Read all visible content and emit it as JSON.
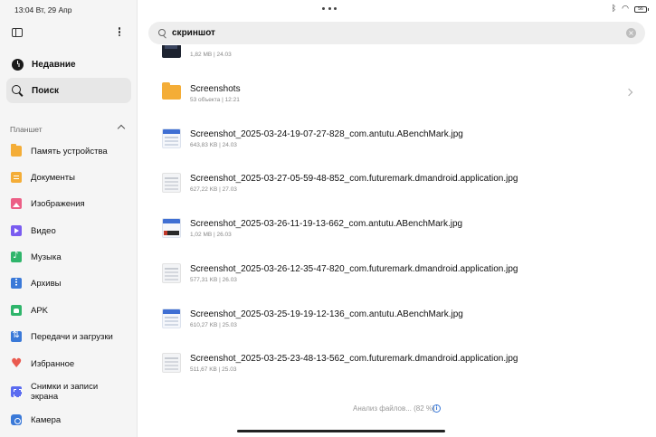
{
  "status_bar": {
    "time_date": "13:04  Вт, 29 Апр",
    "battery": "56"
  },
  "sidebar": {
    "top_items": [
      {
        "label": "Недавние",
        "icon": "clock-icon",
        "active": false
      },
      {
        "label": "Поиск",
        "icon": "search-icon",
        "active": true
      }
    ],
    "section_title": "Планшет",
    "categories": [
      {
        "label": "Память устройства",
        "icon": "folder-icon",
        "color": "#f4ad37"
      },
      {
        "label": "Документы",
        "icon": "document-icon",
        "color": "#f4ad37"
      },
      {
        "label": "Изображения",
        "icon": "image-icon",
        "color": "#ec5f86"
      },
      {
        "label": "Видео",
        "icon": "video-icon",
        "color": "#7a5cf0"
      },
      {
        "label": "Музыка",
        "icon": "music-icon",
        "color": "#2fb56b"
      },
      {
        "label": "Архивы",
        "icon": "archive-icon",
        "color": "#3a79d8"
      },
      {
        "label": "APK",
        "icon": "apk-icon",
        "color": "#2fb56b"
      },
      {
        "label": "Передачи и загрузки",
        "icon": "transfer-icon",
        "color": "#3a79d8"
      },
      {
        "label": "Избранное",
        "icon": "heart-icon",
        "color": "#ea5a4f"
      },
      {
        "label": "Снимки и записи экрана",
        "icon": "screen-capture-icon",
        "color": "#5b6cf0"
      },
      {
        "label": "Камера",
        "icon": "camera-icon",
        "color": "#3a79d8"
      }
    ]
  },
  "search": {
    "value": "скриншот"
  },
  "results": [
    {
      "name": "",
      "meta": "1,82 MB  |  24.03",
      "icon": "dark-thumbnail"
    },
    {
      "name": "Screenshots",
      "meta": "53 объекта  |  12:21",
      "icon": "folder-icon"
    },
    {
      "name": "Screenshot_2025-03-24-19-07-27-828_com.antutu.ABenchMark.jpg",
      "meta": "643,83 KB  |  24.03",
      "icon": "blue-thumbnail"
    },
    {
      "name": "Screenshot_2025-03-27-05-59-48-852_com.futuremark.dmandroid.application.jpg",
      "meta": "627,22 KB  |  27.03",
      "icon": "light-thumbnail"
    },
    {
      "name": "Screenshot_2025-03-26-11-19-13-662_com.antutu.ABenchMark.jpg",
      "meta": "1,02 MB  |  26.03",
      "icon": "blue-dark-thumbnail"
    },
    {
      "name": "Screenshot_2025-03-26-12-35-47-820_com.futuremark.dmandroid.application.jpg",
      "meta": "577,31 KB  |  26.03",
      "icon": "light-thumbnail"
    },
    {
      "name": "Screenshot_2025-03-25-19-19-12-136_com.antutu.ABenchMark.jpg",
      "meta": "610,27 KB  |  25.03",
      "icon": "blue-thumbnail"
    },
    {
      "name": "Screenshot_2025-03-25-23-48-13-562_com.futuremark.dmandroid.application.jpg",
      "meta": "511,67 KB  |  25.03",
      "icon": "light-thumbnail"
    }
  ],
  "footer": {
    "analysis_text": "Анализ файлов... (82 %)"
  }
}
